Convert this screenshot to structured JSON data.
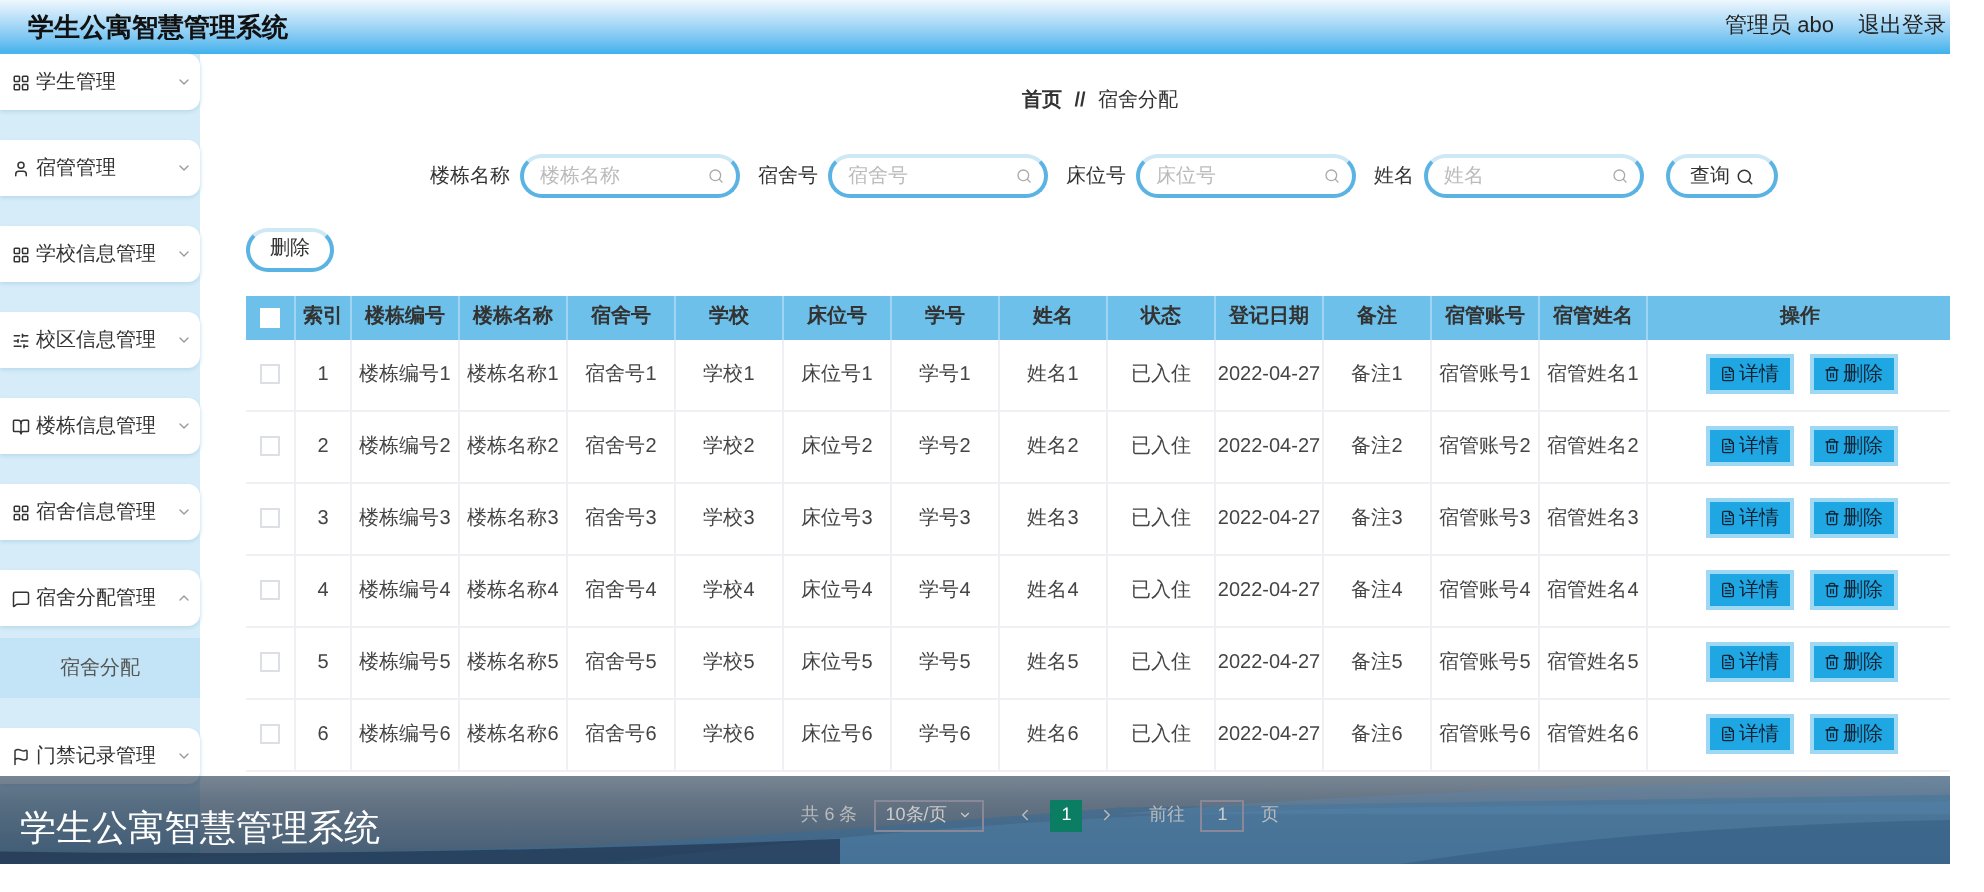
{
  "header": {
    "title": "学生公寓智慧管理系统",
    "user": "管理员 abo",
    "logout": "退出登录"
  },
  "sidebar": {
    "items": [
      {
        "label": "学生管理",
        "expanded": false
      },
      {
        "label": "宿管管理",
        "expanded": false
      },
      {
        "label": "学校信息管理",
        "expanded": false
      },
      {
        "label": "校区信息管理",
        "expanded": false
      },
      {
        "label": "楼栋信息管理",
        "expanded": false
      },
      {
        "label": "宿舍信息管理",
        "expanded": false
      },
      {
        "label": "宿舍分配管理",
        "expanded": true,
        "children": [
          {
            "label": "宿舍分配",
            "selected": true
          }
        ]
      },
      {
        "label": "门禁记录管理",
        "expanded": false
      }
    ]
  },
  "breadcrumb": {
    "home": "首页",
    "separator": "//",
    "current": "宿舍分配"
  },
  "search": {
    "fields": [
      {
        "label": "楼栋名称",
        "placeholder": "楼栋名称"
      },
      {
        "label": "宿舍号",
        "placeholder": "宿舍号"
      },
      {
        "label": "床位号",
        "placeholder": "床位号"
      },
      {
        "label": "姓名",
        "placeholder": "姓名"
      }
    ],
    "button": "查询"
  },
  "delete_button": "删除",
  "table": {
    "select_all_checked": false,
    "columns": [
      "索引",
      "楼栋编号",
      "楼栋名称",
      "宿舍号",
      "学校",
      "床位号",
      "学号",
      "姓名",
      "状态",
      "登记日期",
      "备注",
      "宿管账号",
      "宿管姓名",
      "操作"
    ],
    "rows": [
      {
        "checked": false,
        "cells": [
          "1",
          "楼栋编号1",
          "楼栋名称1",
          "宿舍号1",
          "学校1",
          "床位号1",
          "学号1",
          "姓名1",
          "已入住",
          "2022-04-27",
          "备注1",
          "宿管账号1",
          "宿管姓名1"
        ],
        "actions": [
          "详情",
          "删除"
        ]
      },
      {
        "checked": false,
        "cells": [
          "2",
          "楼栋编号2",
          "楼栋名称2",
          "宿舍号2",
          "学校2",
          "床位号2",
          "学号2",
          "姓名2",
          "已入住",
          "2022-04-27",
          "备注2",
          "宿管账号2",
          "宿管姓名2"
        ],
        "actions": [
          "详情",
          "删除"
        ]
      },
      {
        "checked": false,
        "cells": [
          "3",
          "楼栋编号3",
          "楼栋名称3",
          "宿舍号3",
          "学校3",
          "床位号3",
          "学号3",
          "姓名3",
          "已入住",
          "2022-04-27",
          "备注3",
          "宿管账号3",
          "宿管姓名3"
        ],
        "actions": [
          "详情",
          "删除"
        ]
      },
      {
        "checked": false,
        "cells": [
          "4",
          "楼栋编号4",
          "楼栋名称4",
          "宿舍号4",
          "学校4",
          "床位号4",
          "学号4",
          "姓名4",
          "已入住",
          "2022-04-27",
          "备注4",
          "宿管账号4",
          "宿管姓名4"
        ],
        "actions": [
          "详情",
          "删除"
        ]
      },
      {
        "checked": false,
        "cells": [
          "5",
          "楼栋编号5",
          "楼栋名称5",
          "宿舍号5",
          "学校5",
          "床位号5",
          "学号5",
          "姓名5",
          "已入住",
          "2022-04-27",
          "备注5",
          "宿管账号5",
          "宿管姓名5"
        ],
        "actions": [
          "详情",
          "删除"
        ]
      },
      {
        "checked": false,
        "cells": [
          "6",
          "楼栋编号6",
          "楼栋名称6",
          "宿舍号6",
          "学校6",
          "床位号6",
          "学号6",
          "姓名6",
          "已入住",
          "2022-04-27",
          "备注6",
          "宿管账号6",
          "宿管姓名6"
        ],
        "actions": [
          "详情",
          "删除"
        ]
      }
    ]
  },
  "pagination": {
    "total": "共 6 条",
    "page_size": "10条/页",
    "pages": [
      {
        "label": "1",
        "selected": true
      }
    ],
    "goto_label": "前往",
    "goto_value": "1",
    "goto_suffix": "页"
  },
  "caption": "学生公寓智慧管理系统"
}
